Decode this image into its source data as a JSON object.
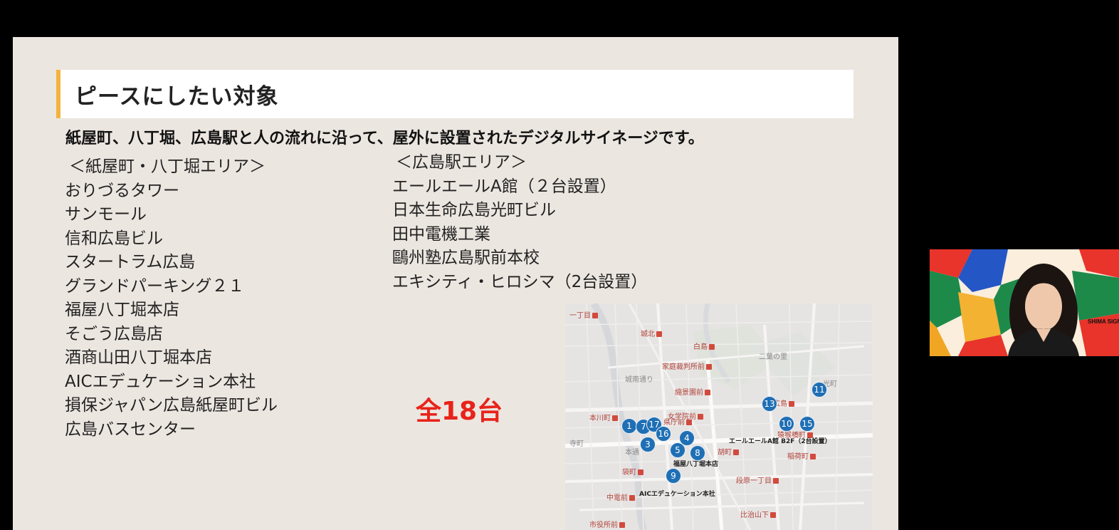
{
  "slide": {
    "title": "ピースにしたい対象",
    "subtitle": "紙屋町、八丁堀、広島駅と人の流れに沿って、屋外に設置されたデジタルサイネージです。",
    "left_column": {
      "header": "＜紙屋町・八丁堀エリア＞",
      "items": [
        "おりづるタワー",
        "サンモール",
        "信和広島ビル",
        "スタートラム広島",
        "グランドパーキング２１",
        "福屋八丁堀本店",
        "そごう広島店",
        "酒商山田八丁堀本店",
        "AICエデュケーション本社",
        "損保ジャパン広島紙屋町ビル",
        "広島バスセンター"
      ]
    },
    "right_column": {
      "header": "＜広島駅エリア＞",
      "items": [
        "エールエールA館（２台設置）",
        "日本生命広島光町ビル",
        "田中電機工業",
        "鷗州塾広島駅前本校",
        "エキシティ・ヒロシマ（2台設置）"
      ]
    },
    "total_label": "全18台",
    "map": {
      "labels": [
        "一丁目",
        "城北",
        "白島",
        "家庭裁判所前",
        "縮景園前",
        "女学院前",
        "本川町",
        "県庁前",
        "胡町",
        "稲荷町",
        "袋町",
        "段原一丁目",
        "中電前",
        "比治山下",
        "市役所前",
        "猿猴橋町",
        "広島",
        "二葉の里",
        "光町",
        "城南通り",
        "寺町",
        "本通"
      ],
      "annotations": [
        "エールエールA館 B2F（2台設置）",
        "福屋八丁堀本店",
        "AICエデュケーション本社"
      ],
      "pins": [
        "1",
        "7",
        "17",
        "16",
        "3",
        "4",
        "5",
        "8",
        "9",
        "13",
        "11",
        "10",
        "15"
      ]
    },
    "webcam": {
      "logo_text": "SHIMA SIGN MOR"
    },
    "colors": {
      "accent": "#f3b33d",
      "total": "#e8231a",
      "pin": "#1f6fb5",
      "slide_bg": "#ece6e0"
    }
  }
}
